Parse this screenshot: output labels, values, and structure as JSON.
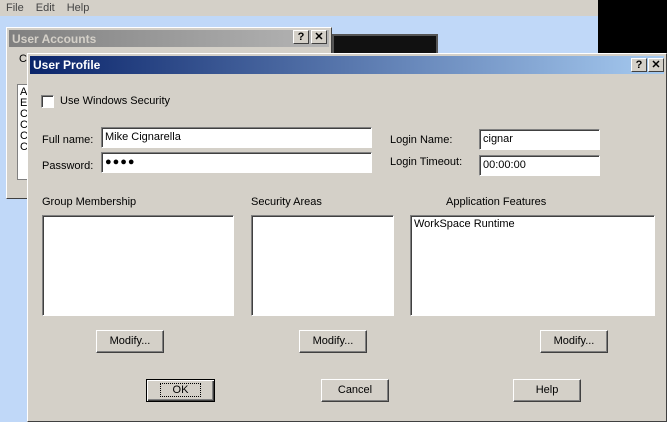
{
  "menu": {
    "items": [
      "File",
      "Edit",
      "Help"
    ]
  },
  "user_accounts": {
    "title": "User Accounts",
    "label_partial": "C",
    "list_partial": [
      "A",
      "E",
      "C",
      "C",
      "C",
      "C"
    ]
  },
  "user_profile": {
    "title": "User Profile",
    "help_btn": "?",
    "close_btn": "✕",
    "use_windows_security": {
      "label": "Use Windows Security",
      "checked": false
    },
    "full_name": {
      "label": "Full name:",
      "value": "Mike Cignarella"
    },
    "password": {
      "label": "Password:",
      "value": "●●●●"
    },
    "login_name": {
      "label": "Login Name:",
      "value": "cignar"
    },
    "login_timeout": {
      "label": "Login Timeout:",
      "value": "00:00:00"
    },
    "group_membership": {
      "label": "Group Membership",
      "items": []
    },
    "security_areas": {
      "label": "Security Areas",
      "items": []
    },
    "application_features": {
      "label": "Application Features",
      "items": [
        "WorkSpace Runtime"
      ]
    },
    "modify_label": "Modify...",
    "ok_label": "OK",
    "cancel_label": "Cancel",
    "help_label": "Help"
  }
}
